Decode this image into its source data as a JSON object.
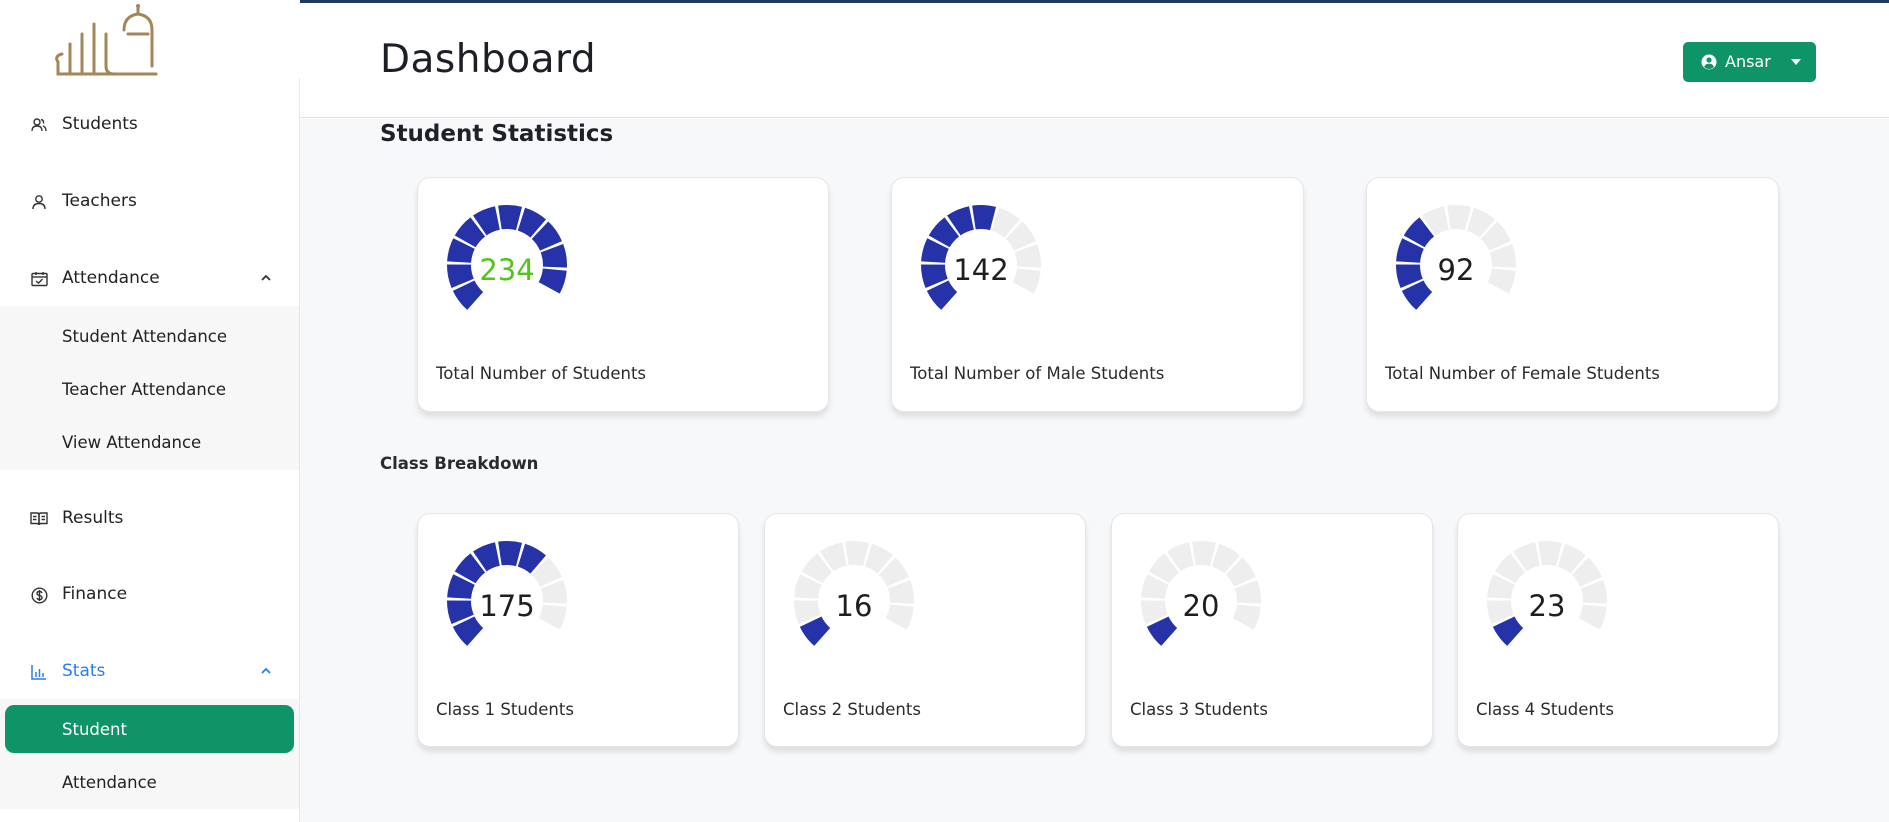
{
  "sidebar": {
    "items": [
      {
        "label": "Students",
        "icon": "students-icon"
      },
      {
        "label": "Teachers",
        "icon": "teacher-icon"
      },
      {
        "label": "Attendance",
        "icon": "calendar-icon"
      },
      {
        "label": "Results",
        "icon": "book-icon"
      },
      {
        "label": "Finance",
        "icon": "dollar-icon"
      },
      {
        "label": "Stats",
        "icon": "chart-icon"
      }
    ],
    "attendance_sub": [
      "Student Attendance",
      "Teacher Attendance",
      "View Attendance"
    ],
    "stats_sub": [
      "Student",
      "Attendance"
    ]
  },
  "header": {
    "title": "Dashboard",
    "user_name": "Ansar"
  },
  "main": {
    "section_title": "Student Statistics",
    "section_sub": "Class Breakdown",
    "stats_cards": [
      {
        "value": "234",
        "label": "Total Number of Students",
        "filled_segments": 10,
        "value_color": "#52c41a"
      },
      {
        "value": "142",
        "label": "Total Number of Male Students",
        "filled_segments": 6,
        "value_color": "#1e1e1e"
      },
      {
        "value": "92",
        "label": "Total Number of Female Students",
        "filled_segments": 4,
        "value_color": "#1e1e1e"
      }
    ],
    "class_cards": [
      {
        "value": "175",
        "label": "Class 1 Students",
        "filled_segments": 7
      },
      {
        "value": "16",
        "label": "Class 2 Students",
        "filled_segments": 1
      },
      {
        "value": "20",
        "label": "Class 3 Students",
        "filled_segments": 1
      },
      {
        "value": "23",
        "label": "Class 4 Students",
        "filled_segments": 1
      }
    ]
  },
  "colors": {
    "accent": "#0f9467",
    "gauge_filled": "#2632a8",
    "gauge_empty": "#eeeeee",
    "active_link": "#2b7de9"
  }
}
